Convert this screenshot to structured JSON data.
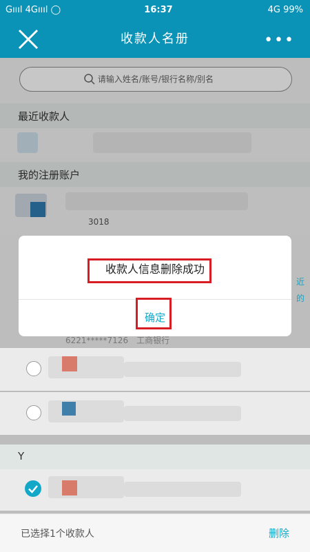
{
  "status_bar": {
    "left": "Gıııl 4Gıııl ◯",
    "time": "16:37",
    "right": "4G 99%"
  },
  "nav": {
    "title": "收款人名册",
    "more": "•••"
  },
  "search": {
    "placeholder": "请输入姓名/账号/银行名称/别名"
  },
  "sections": {
    "recent": "最近收款人",
    "registered": "我的注册账户",
    "group_y": "Y"
  },
  "background_text": {
    "masked_number_1": "3018",
    "account_line": "6221*****7126　工商银行",
    "side_text_1": "近",
    "side_text_2": "的"
  },
  "dialog": {
    "message": "收款人信息删除成功",
    "confirm": "确定"
  },
  "footer": {
    "selected_text": "已选择1个收款人",
    "delete": "删除"
  },
  "colors": {
    "brand": "#0b93b7",
    "accent": "#13a8c8",
    "highlight_box": "#d81c24"
  }
}
